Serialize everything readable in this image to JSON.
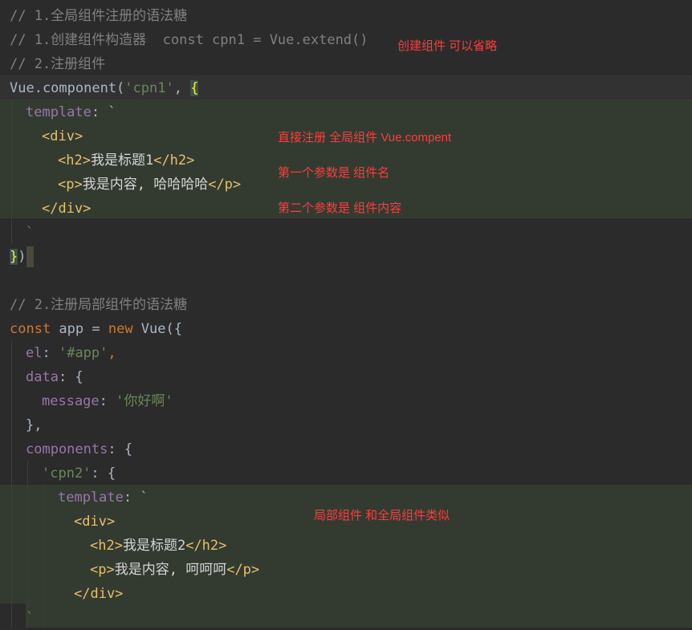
{
  "code": {
    "l1": "// 1.全局组件注册的语法糖",
    "l2": "// 1.创建组件构造器  const cpn1 = Vue.extend()",
    "l3": "// 2.注册组件",
    "l4a": "Vue.component(",
    "l4b": "'cpn1'",
    "l4c": ", ",
    "l4d": "{",
    "l5a": "template",
    "l5b": ": `",
    "l6": "<div>",
    "l7a": "<h2>",
    "l7b": "我是标题1",
    "l7c": "</h2>",
    "l8a": "<p>",
    "l8b": "我是内容, 哈哈哈哈",
    "l8c": "</p>",
    "l9": "</div>",
    "l10": "`",
    "l11a": "}",
    "l11b": ")",
    "l13": "// 2.注册局部组件的语法糖",
    "l14a": "const",
    "l14b": " app = ",
    "l14c": "new",
    "l14d": " Vue({",
    "l15a": "el",
    "l15b": ": ",
    "l15c": "'#app'",
    "l15d": ",",
    "l16a": "data",
    "l16b": ": {",
    "l17a": "message",
    "l17b": ": ",
    "l17c": "'你好啊'",
    "l18": "},",
    "l19a": "components",
    "l19b": ": {",
    "l20a": "'cpn2'",
    "l20b": ": {",
    "l21a": "template",
    "l21b": ": `",
    "l22": "<div>",
    "l23a": "<h2>",
    "l23b": "我是标题2",
    "l23c": "</h2>",
    "l24a": "<p>",
    "l24b": "我是内容, 呵呵呵",
    "l24c": "</p>",
    "l25": "</div>",
    "l26": "`"
  },
  "notes": {
    "n1": "创建组件 可以省略",
    "n2": "直接注册  全局组件  Vue.compent",
    "n3": "第一个参数是 组件名",
    "n4": "第二个参数是 组件内容",
    "n5": "局部组件 和全局组件类似"
  },
  "colors": {
    "background": "#2b2b2b",
    "template_highlight": "#333b31",
    "comment": "#808080",
    "keyword": "#cc7832",
    "string": "#6a8759",
    "property": "#9876aa",
    "tag": "#e8bf6a",
    "annotation": "#ff3b3b"
  }
}
